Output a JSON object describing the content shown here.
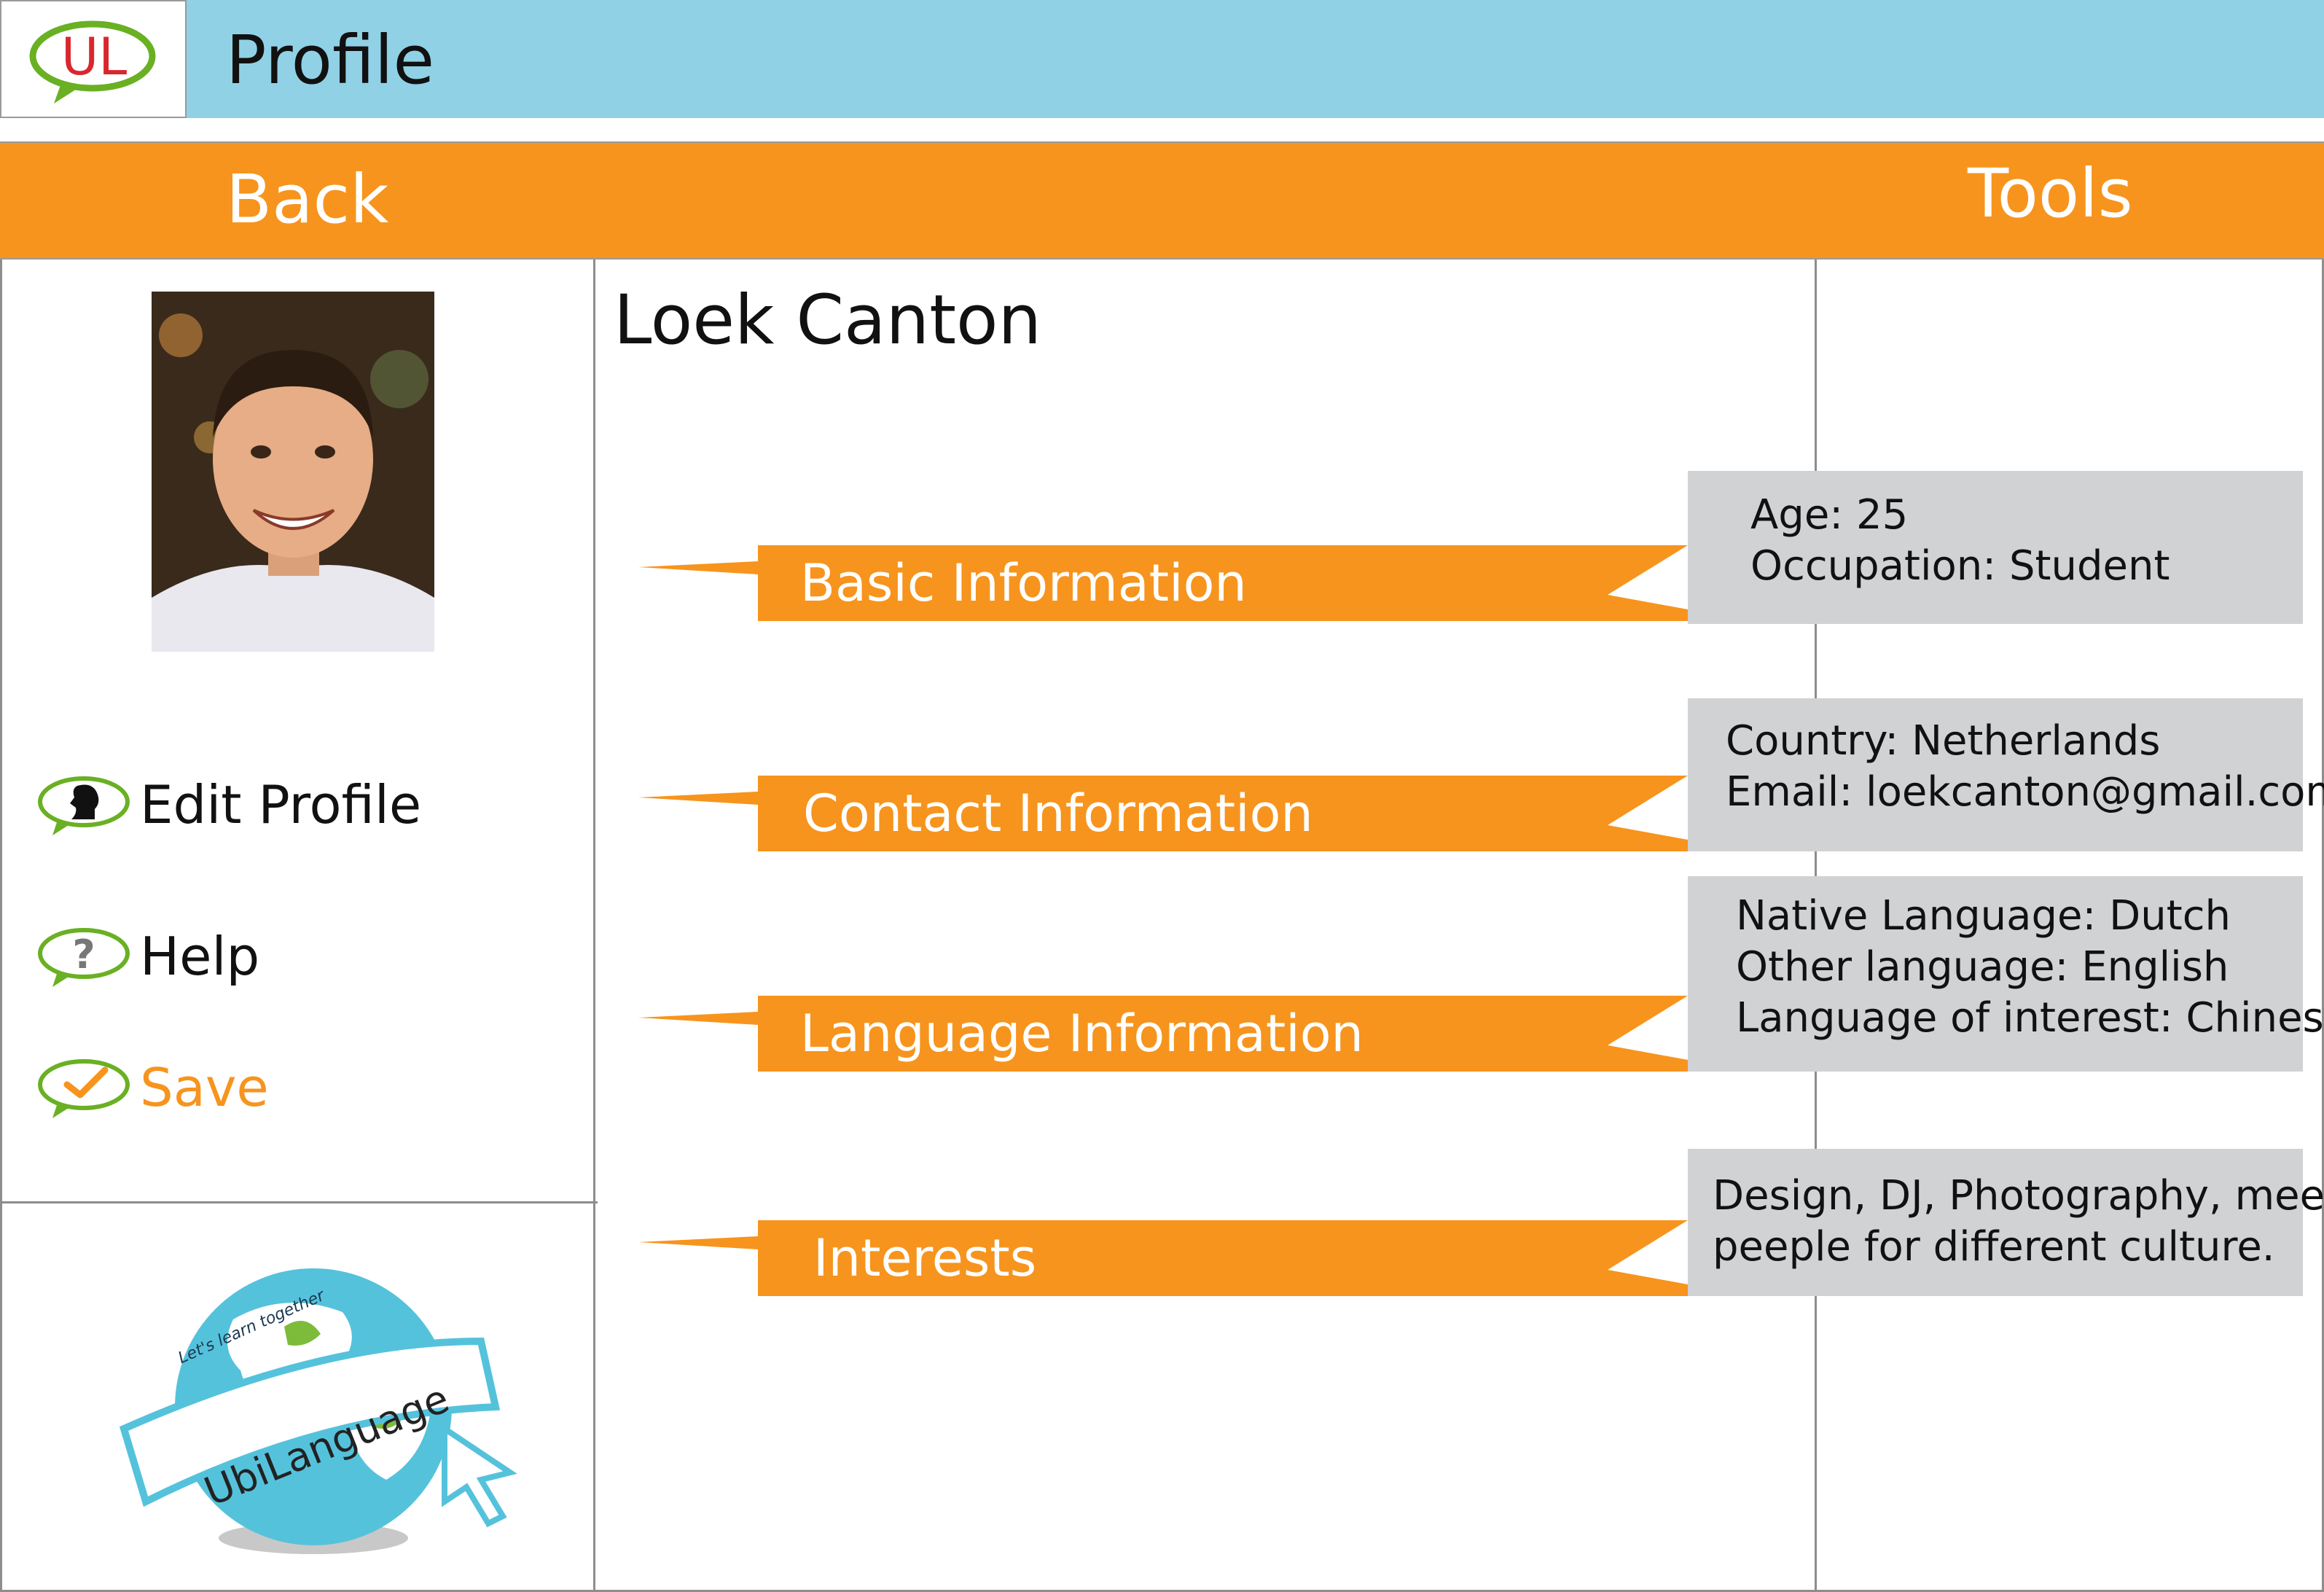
{
  "header": {
    "title": "Profile",
    "logo_text": "UL"
  },
  "nav": {
    "back_label": "Back",
    "tools_label": "Tools"
  },
  "sidebar": {
    "menu": [
      {
        "label": "Edit Profile",
        "icon": "edit-profile-icon"
      },
      {
        "label": "Help",
        "icon": "help-icon"
      },
      {
        "label": "Save",
        "icon": "save-check-icon"
      }
    ],
    "brand": {
      "name": "UbiLanguage",
      "tagline": "Let's learn together"
    }
  },
  "profile": {
    "name": "Loek Canton",
    "sections": [
      {
        "label": "Basic Information",
        "lines": [
          "Age: 25",
          "Occupation: Student"
        ]
      },
      {
        "label": "Contact Information",
        "lines": [
          "Country: Netherlands",
          "Email: loekcanton@gmail.com"
        ]
      },
      {
        "label": "Language Information",
        "lines": [
          "Native Language: Dutch",
          "Other language: English",
          "Language of interest: Chinese"
        ]
      },
      {
        "label": "Interests",
        "lines": [
          "Design, DJ, Photography, meet",
          "peeple for different culture."
        ]
      }
    ]
  },
  "colors": {
    "header_bar": "#90d1e6",
    "accent_orange": "#f7941d",
    "info_box_gray": "#d1d2d4",
    "logo_green": "#6ab023",
    "logo_red": "#d9272e",
    "globe_blue": "#55c2dc"
  }
}
